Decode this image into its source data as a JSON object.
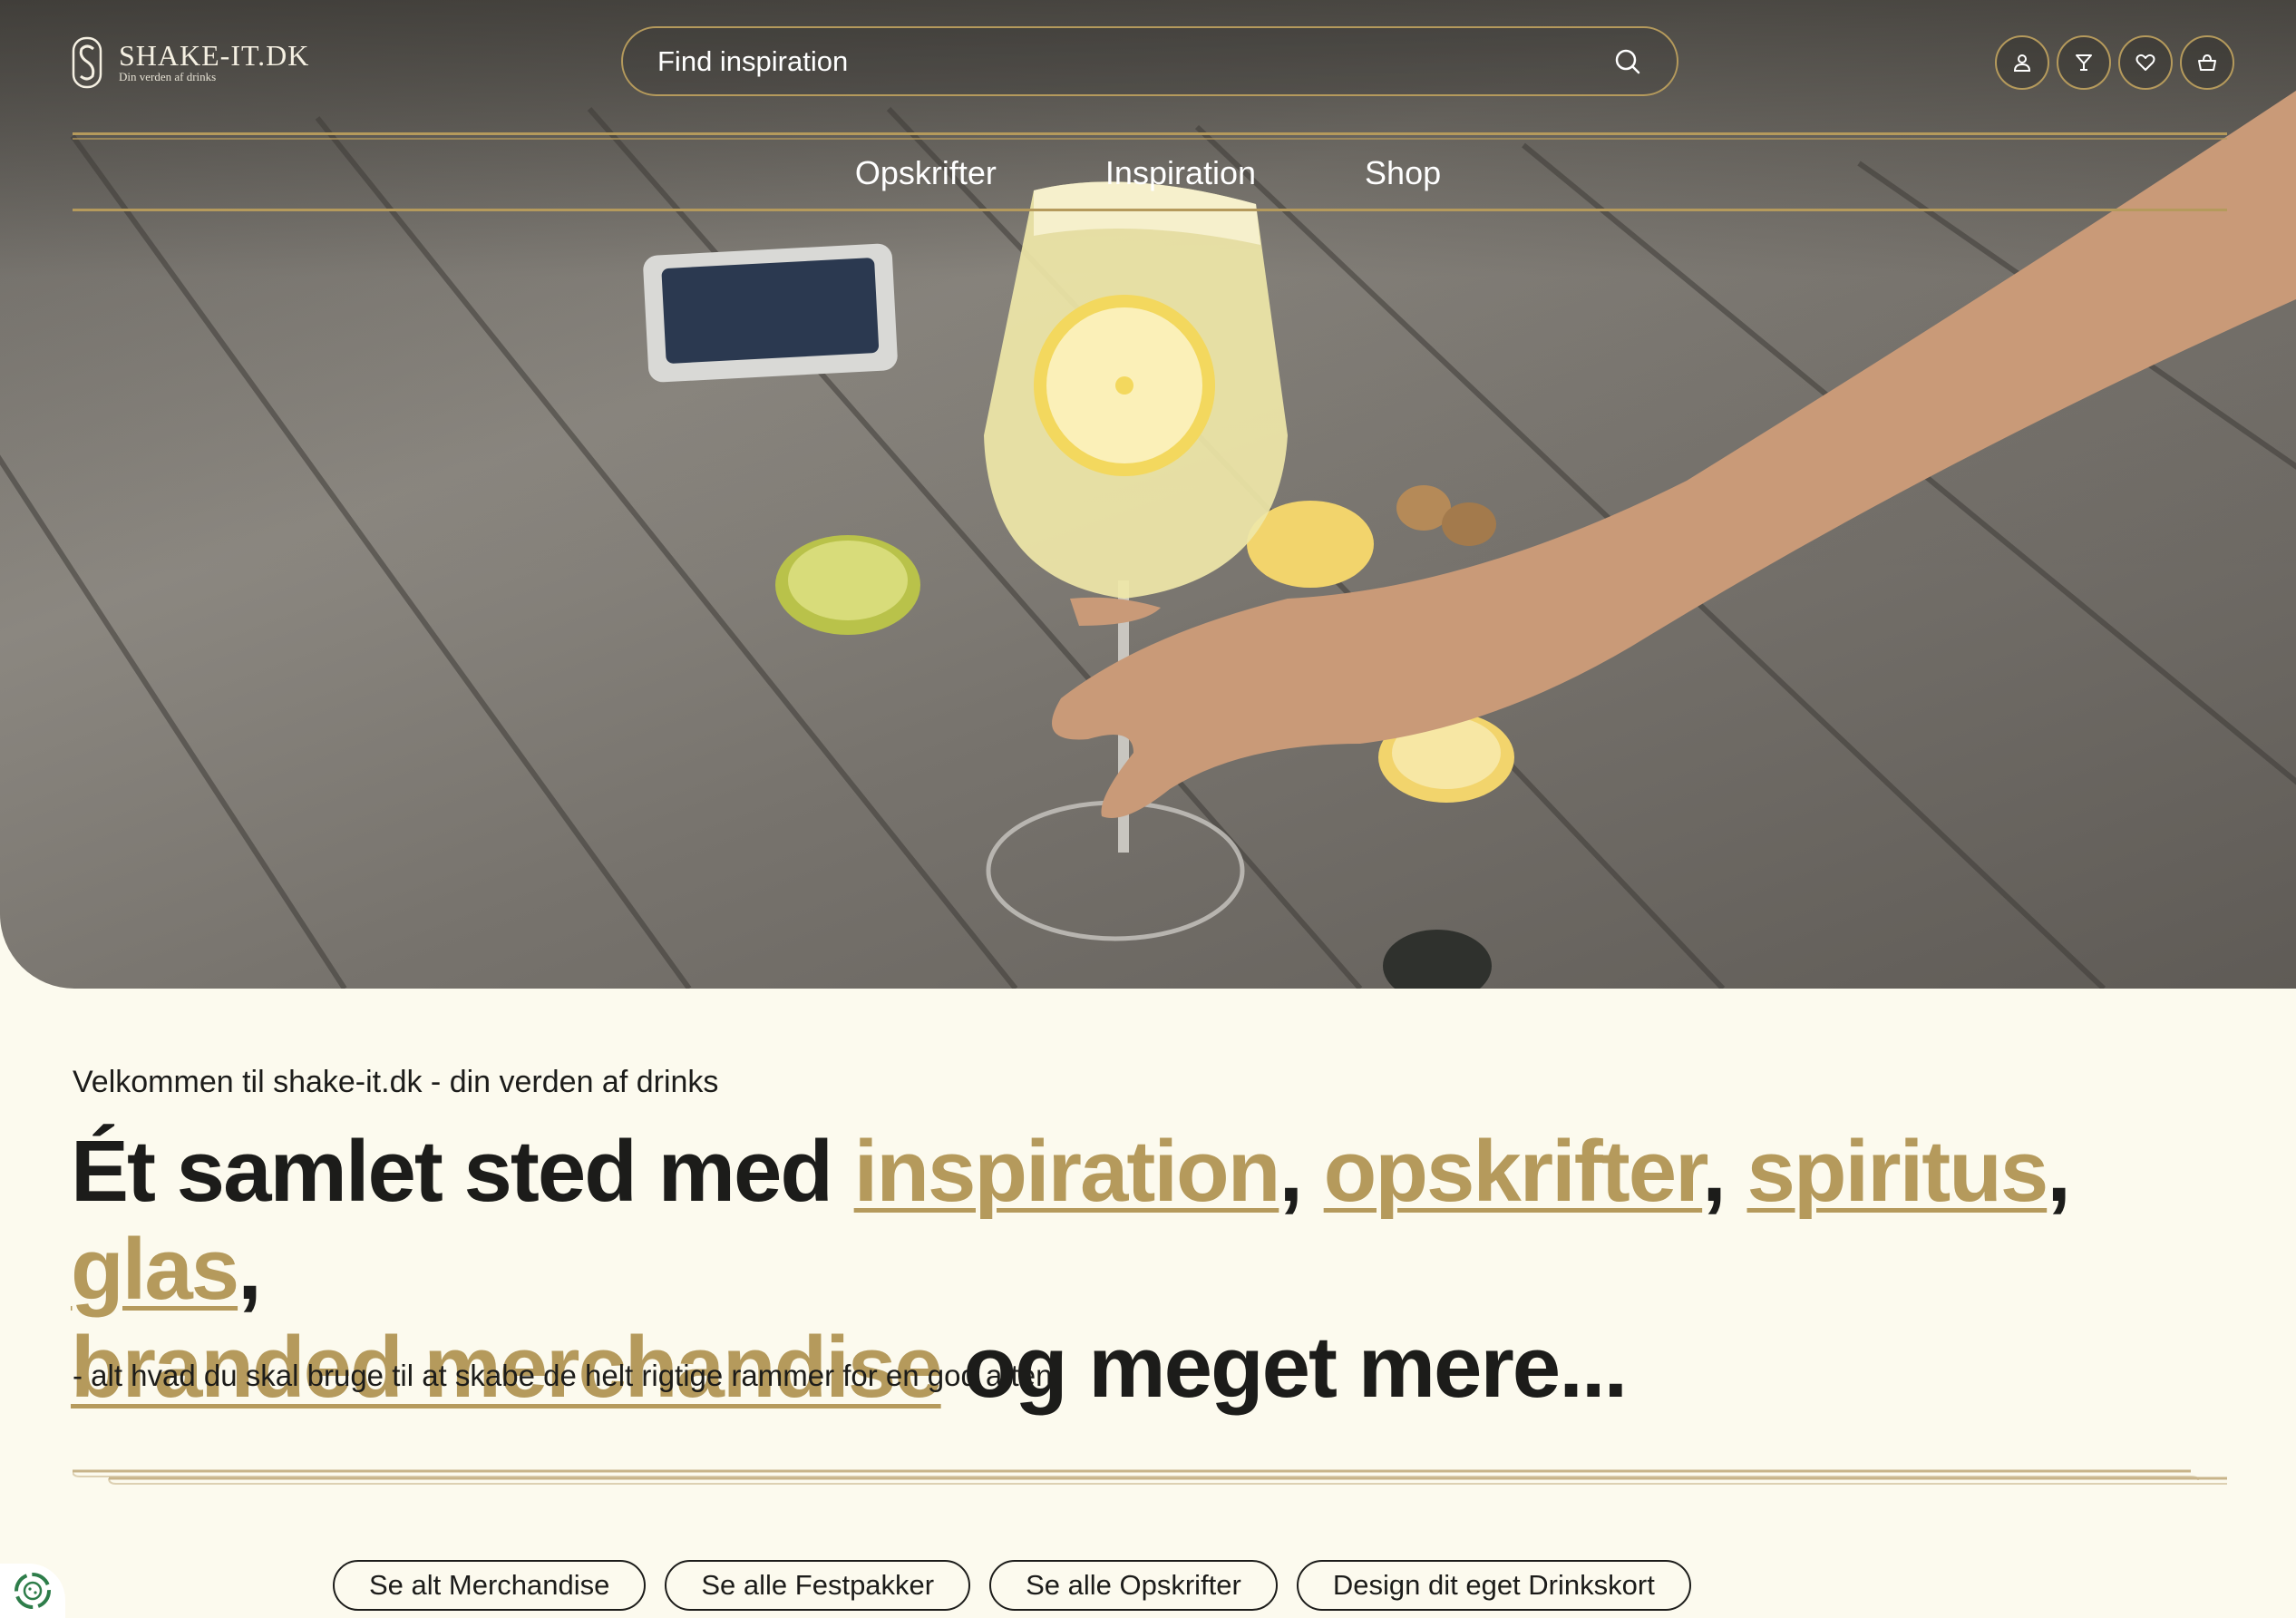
{
  "brand": {
    "name": "SHAKE-IT.DK",
    "tagline": "Din verden af drinks"
  },
  "search": {
    "placeholder": "Find inspiration",
    "icon": "search-icon"
  },
  "header_icons": [
    "user-icon",
    "cocktail-glass-icon",
    "heart-icon",
    "basket-icon"
  ],
  "nav": {
    "items": [
      {
        "label": "Opskrifter"
      },
      {
        "label": "Inspiration"
      },
      {
        "label": "Shop"
      }
    ]
  },
  "intro": {
    "welcome": "Velkommen til shake-it.dk - din verden af drinks",
    "headline_prefix": "Ét samlet sted med ",
    "links": [
      "inspiration",
      "opskrifter",
      "spiritus",
      "glas",
      "branded merchandise"
    ],
    "sep": ", ",
    "comma": ",",
    "headline_suffix": " og meget mere...",
    "subtext": "- alt hvad du skal bruge til at skabe de helt rigtige rammer for en god aften."
  },
  "buttons": [
    {
      "label": "Se alt Merchandise"
    },
    {
      "label": "Se alle Festpakker"
    },
    {
      "label": "Se alle Opskrifter"
    },
    {
      "label": "Design dit eget Drinkskort"
    }
  ],
  "colors": {
    "accent": "#b59a5c",
    "background": "#fcfaee",
    "text": "#1c1c1a"
  }
}
